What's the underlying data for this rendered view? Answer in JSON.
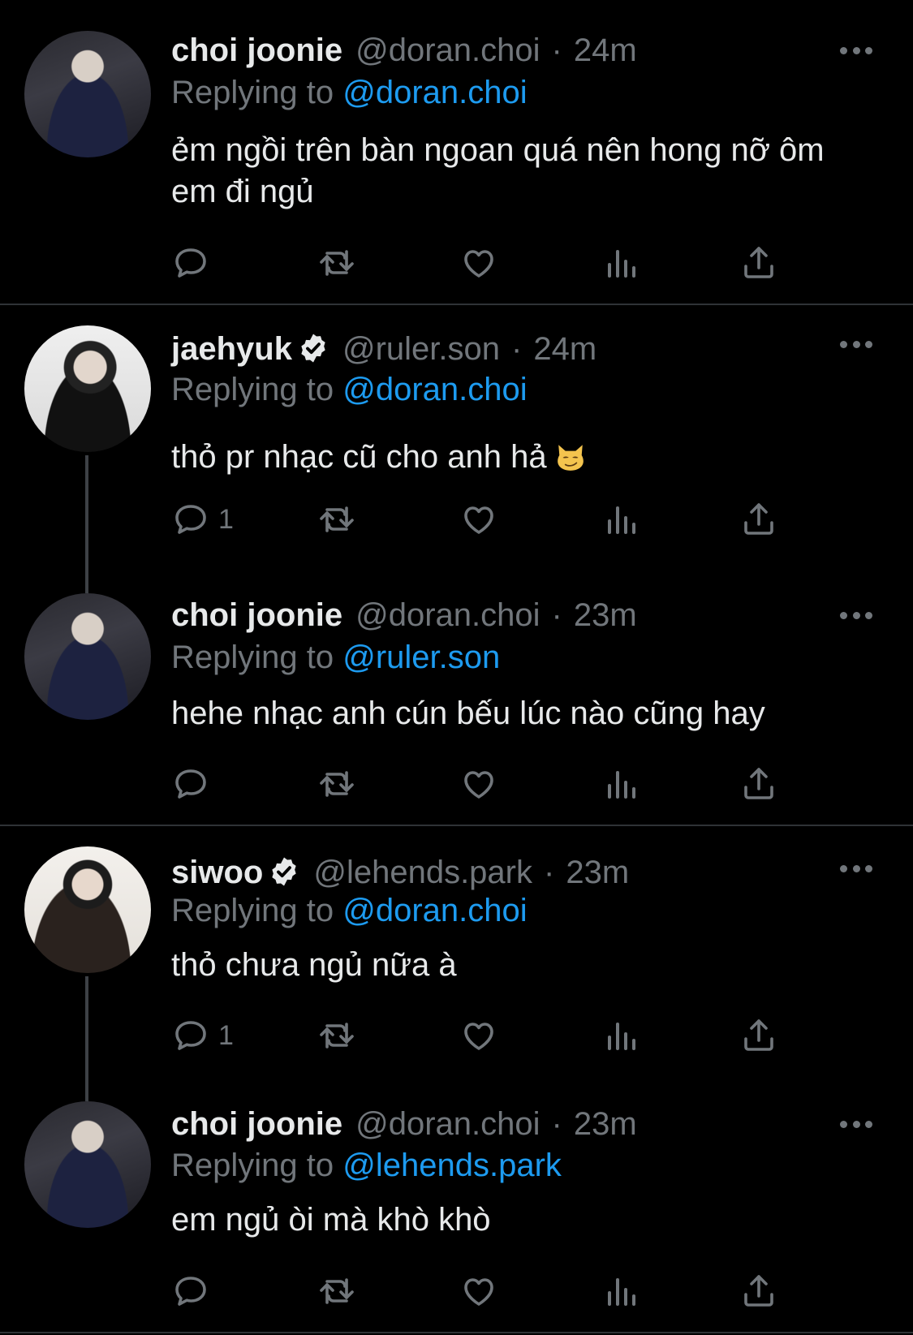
{
  "tweets": [
    {
      "name": "choi joonie",
      "verified": false,
      "handle": "@doran.choi",
      "time": "24m",
      "replying_prefix": "Replying to",
      "replying_to": "@doran.choi",
      "text": "ẻm ngồi trên bàn ngoan quá nên hong nỡ ôm em đi ngủ",
      "reply_count": ""
    },
    {
      "name": "jaehyuk",
      "verified": true,
      "handle": "@ruler.son",
      "time": "24m",
      "replying_prefix": "Replying to",
      "replying_to": "@doran.choi",
      "text": "thỏ pr nhạc cũ cho anh hả",
      "reply_count": "1"
    },
    {
      "name": "choi joonie",
      "verified": false,
      "handle": "@doran.choi",
      "time": "23m",
      "replying_prefix": "Replying to",
      "replying_to": "@ruler.son",
      "text": "hehe nhạc anh cún bếu lúc nào cũng hay",
      "reply_count": ""
    },
    {
      "name": "siwoo",
      "verified": true,
      "handle": "@lehends.park",
      "time": "23m",
      "replying_prefix": "Replying to",
      "replying_to": "@doran.choi",
      "text": "thỏ chưa ngủ nữa à",
      "reply_count": "1"
    },
    {
      "name": "choi joonie",
      "verified": false,
      "handle": "@doran.choi",
      "time": "23m",
      "replying_prefix": "Replying to",
      "replying_to": "@lehends.park",
      "text": "em ngủ òi mà khò khò",
      "reply_count": ""
    }
  ],
  "separator": "·",
  "colors": {
    "background": "#000000",
    "text": "#e7e9ea",
    "muted": "#71767b",
    "link": "#1d9bf0",
    "divider": "#2f3336"
  },
  "icons": [
    "reply-icon",
    "retweet-icon",
    "like-icon",
    "views-icon",
    "share-icon",
    "more-icon",
    "verified-badge-icon",
    "smirking-cat-emoji"
  ]
}
